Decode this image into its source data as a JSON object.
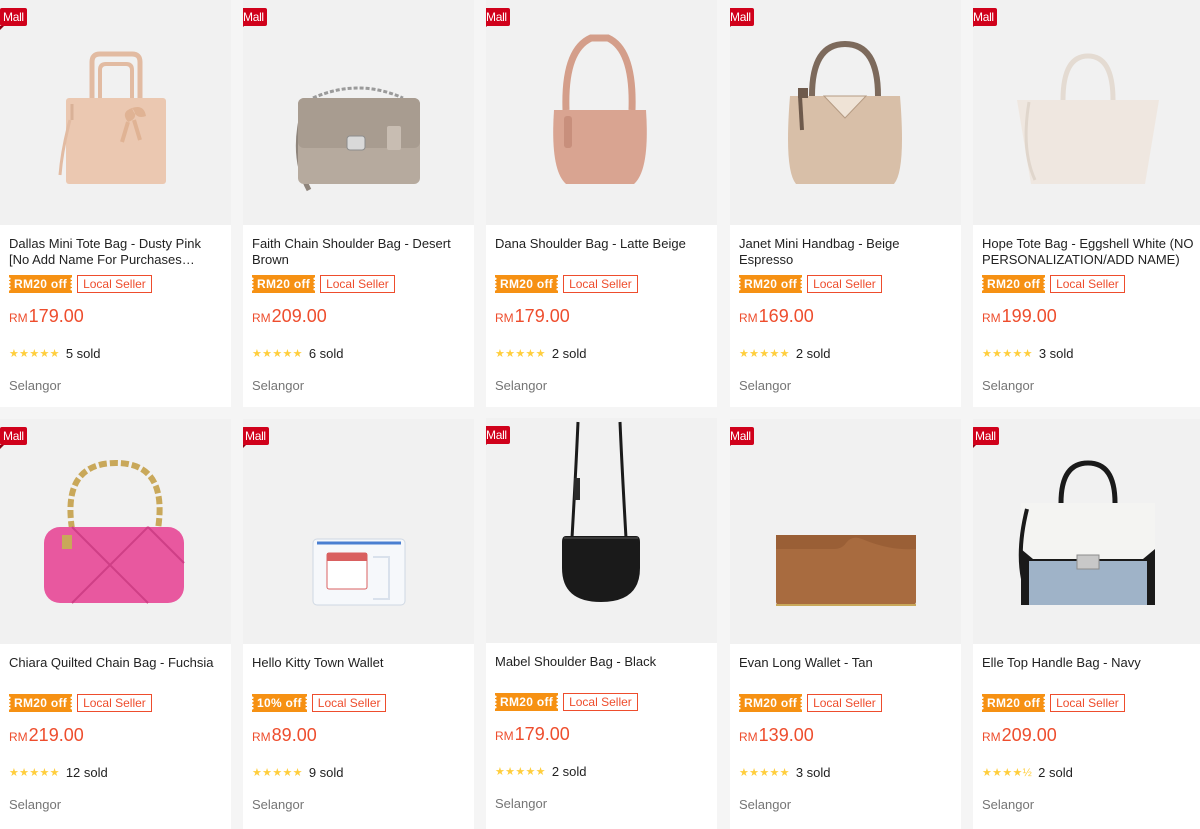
{
  "products": [
    {
      "title": "Dallas Mini Tote Bag - Dusty Pink [No Add Name For Purchases Through Shopee]",
      "mall": "Mall",
      "promo": "RM20 off",
      "seller_tag": "Local Seller",
      "currency": "RM",
      "price": "179.00",
      "stars": "★★★★★",
      "sold": "5 sold",
      "location": "Selangor",
      "image": "tote-bag-image",
      "color": "#e9c4ad"
    },
    {
      "title": "Faith Chain Shoulder Bag - Desert Brown",
      "mall": "Mall",
      "promo": "RM20 off",
      "seller_tag": "Local Seller",
      "currency": "RM",
      "price": "209.00",
      "stars": "★★★★★",
      "sold": "6 sold",
      "location": "Selangor",
      "image": "chain-shoulder-bag-image",
      "color": "#b7aba0"
    },
    {
      "title": "Dana Shoulder Bag - Latte Beige",
      "mall": "Mall",
      "promo": "RM20 off",
      "seller_tag": "Local Seller",
      "currency": "RM",
      "price": "179.00",
      "stars": "★★★★★",
      "sold": "2 sold",
      "location": "Selangor",
      "image": "shoulder-bag-image",
      "color": "#d8a08d"
    },
    {
      "title": "Janet Mini Handbag - Beige Espresso",
      "mall": "Mall",
      "promo": "RM20 off",
      "seller_tag": "Local Seller",
      "currency": "RM",
      "price": "169.00",
      "stars": "★★★★★",
      "sold": "2 sold",
      "location": "Selangor",
      "image": "handbag-image",
      "color": "#d6bba3"
    },
    {
      "title": "Hope Tote Bag - Eggshell White (NO PERSONALIZATION/ADD NAME)",
      "mall": "Mall",
      "promo": "RM20 off",
      "seller_tag": "Local Seller",
      "currency": "RM",
      "price": "199.00",
      "stars": "★★★★★",
      "sold": "3 sold",
      "location": "Selangor",
      "image": "tote-bag-image",
      "color": "#ece4dd"
    },
    {
      "title": "Chiara Quilted Chain Bag - Fuchsia",
      "mall": "Mall",
      "promo": "RM20 off",
      "seller_tag": "Local Seller",
      "currency": "RM",
      "price": "219.00",
      "stars": "★★★★★",
      "sold": "12 sold",
      "location": "Selangor",
      "image": "quilted-chain-bag-image",
      "color": "#e8589f"
    },
    {
      "title": "Hello Kitty Town Wallet",
      "mall": "Mall",
      "promo": "10% off",
      "seller_tag": "Local Seller",
      "currency": "RM",
      "price": "89.00",
      "stars": "★★★★★",
      "sold": "9 sold",
      "location": "Selangor",
      "image": "wallet-pouch-image",
      "color": "#dfe6ee"
    },
    {
      "title": "Mabel Shoulder Bag - Black",
      "mall": "Mall",
      "promo": "RM20 off",
      "seller_tag": "Local Seller",
      "currency": "RM",
      "price": "179.00",
      "stars": "★★★★★",
      "sold": "2 sold",
      "location": "Selangor",
      "image": "crossbody-bag-image",
      "color": "#1a1a1a"
    },
    {
      "title": "Evan Long Wallet - Tan",
      "mall": "Mall",
      "promo": "RM20 off",
      "seller_tag": "Local Seller",
      "currency": "RM",
      "price": "139.00",
      "stars": "★★★★★",
      "sold": "3 sold",
      "location": "Selangor",
      "image": "long-wallet-image",
      "color": "#a86b3f"
    },
    {
      "title": "Elle Top Handle Bag - Navy",
      "mall": "Mall",
      "promo": "RM20 off",
      "seller_tag": "Local Seller",
      "currency": "RM",
      "price": "209.00",
      "stars": "★★★★½",
      "sold": "2 sold",
      "location": "Selangor",
      "image": "top-handle-bag-image",
      "color": "#9fb3c8"
    }
  ],
  "colors": {
    "accent": "#ee4d2d",
    "mall": "#d0011b",
    "promo": "#f69113",
    "star": "#ffce3d"
  }
}
